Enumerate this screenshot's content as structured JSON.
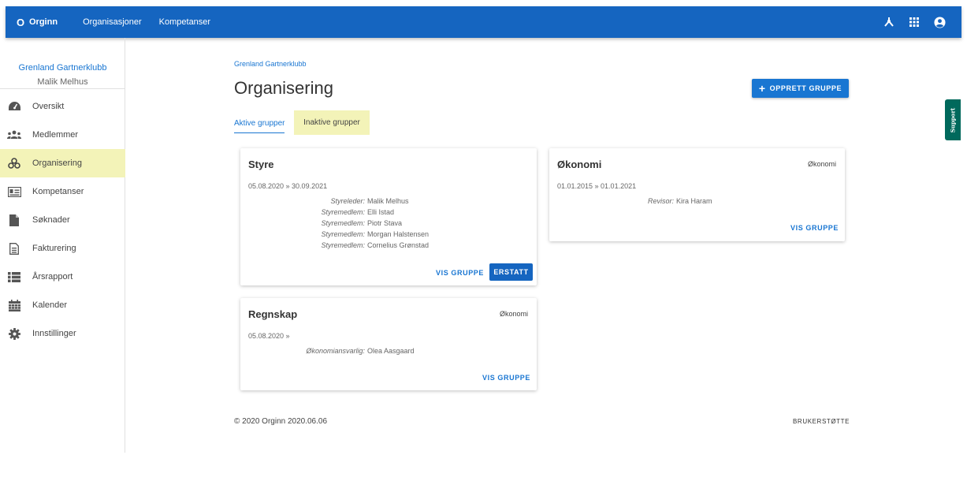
{
  "topbar": {
    "logo_mark": "O",
    "logo_text": "Orginn",
    "nav": [
      "Organisasjoner",
      "Kompetanser"
    ],
    "icons": [
      "hierarchy-icon",
      "apps-grid-icon",
      "account-circle-icon"
    ]
  },
  "sidebar": {
    "org_name": "Grenland Gartnerklubb",
    "user_name": "Malik Melhus",
    "items": [
      {
        "label": "Oversikt",
        "icon": "dashboard-icon"
      },
      {
        "label": "Medlemmer",
        "icon": "people-icon"
      },
      {
        "label": "Organisering",
        "icon": "organization-icon",
        "active": true
      },
      {
        "label": "Kompetanser",
        "icon": "id-card-icon"
      },
      {
        "label": "Søknader",
        "icon": "document-icon"
      },
      {
        "label": "Fakturering",
        "icon": "invoice-icon"
      },
      {
        "label": "Årsrapport",
        "icon": "list-icon"
      },
      {
        "label": "Kalender",
        "icon": "calendar-icon"
      },
      {
        "label": "Innstillinger",
        "icon": "gear-icon"
      }
    ]
  },
  "main": {
    "breadcrumb": "Grenland Gartnerklubb",
    "title": "Organisering",
    "create_button": "OPPRETT GRUPPE",
    "tabs": [
      {
        "label": "Aktive grupper",
        "active": true
      },
      {
        "label": "Inaktive grupper",
        "active": false
      }
    ],
    "groups": [
      {
        "title": "Styre",
        "tag": "",
        "dates": "05.08.2020 » 30.09.2021",
        "members": [
          {
            "role": "Styreleder:",
            "name": "Malik Melhus"
          },
          {
            "role": "Styremedlem:",
            "name": "Elli Istad"
          },
          {
            "role": "Styremedlem:",
            "name": "Piotr Stava"
          },
          {
            "role": "Styremedlem:",
            "name": "Morgan Halstensen"
          },
          {
            "role": "Styremedlem:",
            "name": "Cornelius Grønstad"
          }
        ],
        "view_label": "VIS GRUPPE",
        "replace_label": "ERSTATT"
      },
      {
        "title": "Økonomi",
        "tag": "Økonomi",
        "dates": "01.01.2015 » 01.01.2021",
        "members": [
          {
            "role": "Revisor:",
            "name": "Kira Haram"
          }
        ],
        "view_label": "VIS GRUPPE"
      },
      {
        "title": "Regnskap",
        "tag": "Økonomi",
        "dates": "05.08.2020 »",
        "members": [
          {
            "role": "Økonomiansvarlig:",
            "name": "Olea Aasgaard"
          }
        ],
        "view_label": "VIS GRUPPE"
      }
    ]
  },
  "footer": {
    "copyright": "© 2020 Orginn 2020.06.06",
    "support": "BRUKERSTØTTE"
  },
  "support_tab": "Support"
}
